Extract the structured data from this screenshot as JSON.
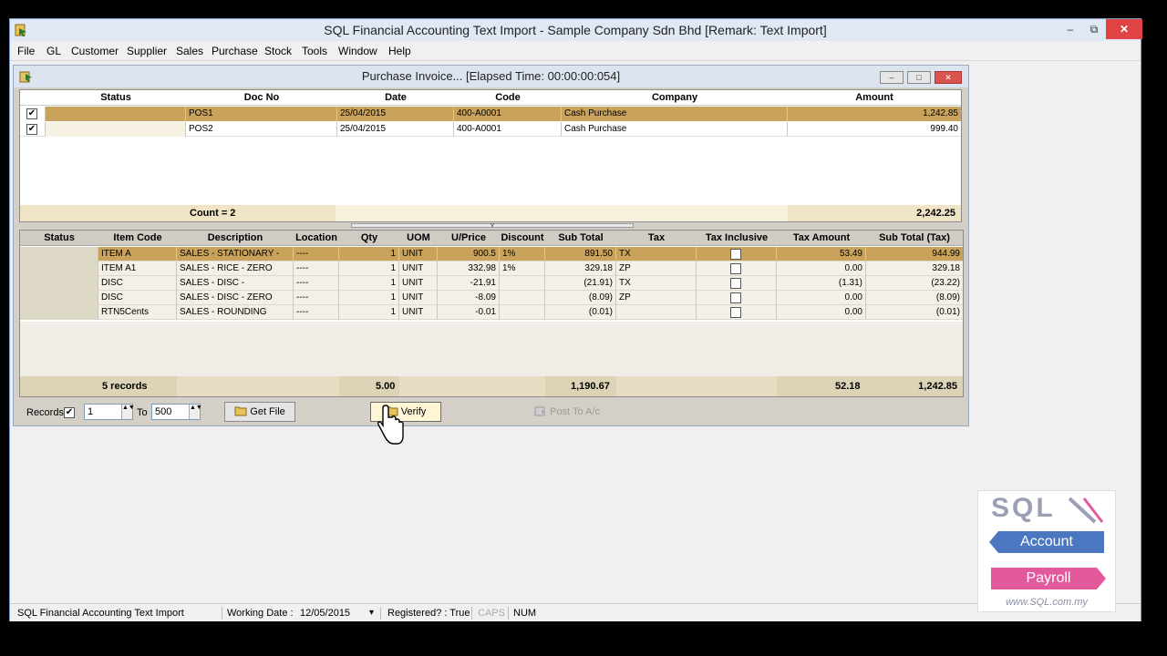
{
  "app": {
    "title": "SQL Financial Accounting Text Import - Sample Company Sdn Bhd [Remark: Text Import]",
    "controls": {
      "minimize": "–",
      "restore": "⧉",
      "close": "✕"
    }
  },
  "menu": [
    "File",
    "GL",
    "Customer",
    "Supplier",
    "Sales",
    "Purchase",
    "Stock",
    "Tools",
    "Window",
    "Help"
  ],
  "child": {
    "title": "Purchase Invoice... [Elapsed Time: 00:00:00:054]",
    "controls": {
      "minimize": "–",
      "maximize": "□",
      "close": "✕"
    }
  },
  "doc_grid": {
    "columns": [
      "Status",
      "Doc No",
      "Date",
      "Code",
      "Company",
      "Amount"
    ],
    "rows": [
      {
        "checked": "✔",
        "doc_no": "POS1",
        "date": "25/04/2015",
        "code": "400-A0001",
        "company": "Cash Purchase",
        "amount": "1,242.85"
      },
      {
        "checked": "✔",
        "doc_no": "POS2",
        "date": "25/04/2015",
        "code": "400-A0001",
        "company": "Cash Purchase",
        "amount": "999.40"
      }
    ],
    "footer": {
      "count": "Count = 2",
      "amount": "2,242.25"
    }
  },
  "splitter_glyph": "˅",
  "detail_grid": {
    "columns": [
      "Status",
      "Item Code",
      "Description",
      "Location",
      "Qty",
      "UOM",
      "U/Price",
      "Discount",
      "Sub Total",
      "Tax",
      "Tax Inclusive",
      "Tax Amount",
      "Sub Total (Tax)"
    ],
    "rows": [
      {
        "item_code": "ITEM A",
        "description": "SALES - STATIONARY -",
        "location": "----",
        "qty": "1",
        "uom": "UNIT",
        "price": "900.5",
        "discount": "1%",
        "sub_total": "891.50",
        "tax": "TX",
        "tax_amount": "53.49",
        "sub_total_tax": "944.99"
      },
      {
        "item_code": "ITEM A1",
        "description": "SALES - RICE - ZERO",
        "location": "----",
        "qty": "1",
        "uom": "UNIT",
        "price": "332.98",
        "discount": "1%",
        "sub_total": "329.18",
        "tax": "ZP",
        "tax_amount": "0.00",
        "sub_total_tax": "329.18"
      },
      {
        "item_code": "DISC",
        "description": "SALES - DISC -",
        "location": "----",
        "qty": "1",
        "uom": "UNIT",
        "price": "-21.91",
        "discount": "",
        "sub_total": "(21.91)",
        "tax": "TX",
        "tax_amount": "(1.31)",
        "sub_total_tax": "(23.22)"
      },
      {
        "item_code": "DISC",
        "description": "SALES - DISC - ZERO",
        "location": "----",
        "qty": "1",
        "uom": "UNIT",
        "price": "-8.09",
        "discount": "",
        "sub_total": "(8.09)",
        "tax": "ZP",
        "tax_amount": "0.00",
        "sub_total_tax": "(8.09)"
      },
      {
        "item_code": "RTN5Cents",
        "description": "SALES - ROUNDING",
        "location": "----",
        "qty": "1",
        "uom": "UNIT",
        "price": "-0.01",
        "discount": "",
        "sub_total": "(0.01)",
        "tax": "",
        "tax_amount": "0.00",
        "sub_total_tax": "(0.01)"
      }
    ],
    "footer": {
      "records": "5 records",
      "qty": "5.00",
      "sub_total": "1,190.67",
      "tax_amount": "52.18",
      "sub_total_tax": "1,242.85"
    }
  },
  "bottom": {
    "records_label": "Records",
    "records_checked": "✔",
    "from_value": "1",
    "to_label": "To",
    "to_value": "500",
    "spin_glyph": "▲▼",
    "get_file": "Get File",
    "verify": "Verify",
    "post": "Post To A/c"
  },
  "status": {
    "app_name": "SQL Financial Accounting Text Import",
    "working_date_label": "Working Date :",
    "working_date": "12/05/2015",
    "dropdown_glyph": "▾",
    "registered": "Registered? : True",
    "caps": "CAPS",
    "num": "NUM"
  },
  "logo": {
    "sql": "SQL",
    "account": "Account",
    "payroll": "Payroll",
    "url": "www.SQL.com.my"
  },
  "colors": {
    "selected_row": "#c9a35b",
    "footer_band": "#ddd3b6",
    "close_red": "#e04343",
    "logo_blue": "#4a77c0",
    "logo_pink": "#e35a9c"
  }
}
